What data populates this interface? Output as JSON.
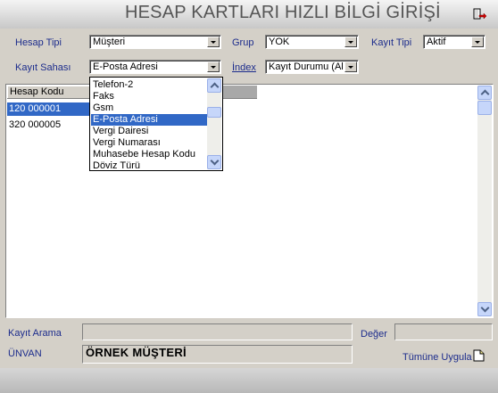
{
  "header": {
    "title": "HESAP KARTLARI HIZLI BİLGİ GİRİŞİ",
    "exit_icon": "exit-door-icon"
  },
  "filters": {
    "hesap_tipi": {
      "label": "Hesap Tipi",
      "value": "Müşteri"
    },
    "grup": {
      "label": "Grup",
      "value": "YOK"
    },
    "kayit_tipi": {
      "label": "Kayıt Tipi",
      "value": "Aktif"
    },
    "kayit_sahasi": {
      "label": "Kayıt Sahası",
      "value": "E-Posta Adresi"
    },
    "index": {
      "label": "İndex",
      "value": "Kayıt Durumu (Ak"
    }
  },
  "grid": {
    "column_header": "Hesap Kodu",
    "rows": [
      "120 000001",
      "320 000005"
    ],
    "selected_row": 0
  },
  "dropdown": {
    "options": [
      "Telefon-2",
      "Faks",
      "Gsm",
      "E-Posta Adresi",
      "Vergi Dairesi",
      "Vergi Numarası",
      "Muhasebe Hesap Kodu",
      "Döviz Türü"
    ],
    "selected_index": 3
  },
  "bottom": {
    "kayit_arama_label": "Kayıt Arama",
    "kayit_arama_value": "",
    "deger_label": "Değer",
    "deger_value": "",
    "unvan_label": "ÜNVAN",
    "unvan_value": "ÖRNEK MÜŞTERİ",
    "apply_label": "Tümüne Uygula",
    "apply_icon": "document-icon"
  },
  "colors": {
    "selection": "#3168c6",
    "label": "#1c2c8c",
    "background": "#d4d0c8"
  }
}
